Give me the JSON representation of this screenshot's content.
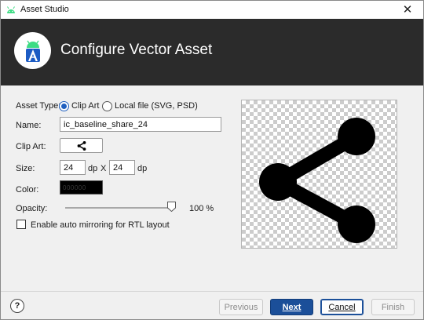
{
  "window": {
    "title": "Asset Studio",
    "close_icon": "close-icon"
  },
  "header": {
    "title": "Configure Vector Asset",
    "logo_icon": "android-studio-logo-icon"
  },
  "form": {
    "asset_type": {
      "label": "Asset Type:",
      "options": [
        {
          "label": "Clip Art",
          "selected": true
        },
        {
          "label": "Local file (SVG, PSD)",
          "selected": false
        }
      ]
    },
    "name": {
      "label": "Name:",
      "value": "ic_baseline_share_24"
    },
    "clip_art": {
      "label": "Clip Art:",
      "icon": "share-icon"
    },
    "size": {
      "label": "Size:",
      "width": "24",
      "width_unit": "dp",
      "separator": "X",
      "height": "24",
      "height_unit": "dp"
    },
    "color": {
      "label": "Color:",
      "value": "000000",
      "swatch": "#000000"
    },
    "opacity": {
      "label": "Opacity:",
      "value": "100 %",
      "level": 1.0
    },
    "rtl_mirroring": {
      "label": "Enable auto mirroring for RTL layout",
      "checked": false
    }
  },
  "preview": {
    "icon": "share-icon",
    "background": "transparency-checkerboard"
  },
  "footer": {
    "help_label": "?",
    "previous_label": "Previous",
    "next_label": "Next",
    "cancel_label": "Cancel",
    "finish_label": "Finish"
  },
  "colors": {
    "header_bg": "#2b2b2b",
    "accent": "#1b4f99",
    "radio": "#1f5fbf"
  }
}
